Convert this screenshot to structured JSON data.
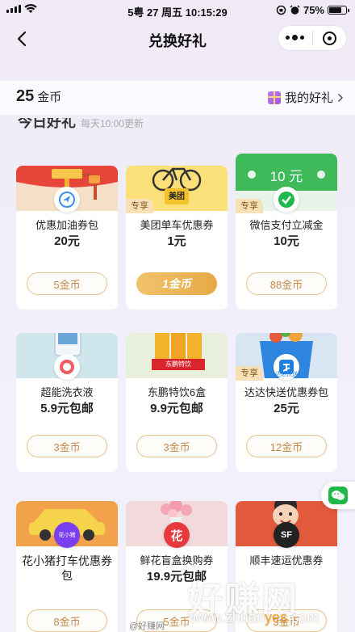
{
  "status_bar": {
    "center": "5粤 27 周五 10:15:29",
    "battery": "75%",
    "battery_level": 0.75
  },
  "nav": {
    "title": "兑换好礼"
  },
  "coins": {
    "amount": "25",
    "unit": "金币",
    "my_gifts": "我的好礼"
  },
  "section": {
    "title": "今日好礼",
    "subtitle": "每天10:00更新"
  },
  "cards": [
    {
      "name": "优惠加油券包",
      "price": "20元",
      "cost": "5金币",
      "tag": "",
      "active": false
    },
    {
      "name": "美团单车优惠券",
      "price": "1元",
      "cost": "1金币",
      "tag": "专享",
      "active": true
    },
    {
      "name": "微信支付立减金",
      "price": "10元",
      "cost": "88金币",
      "tag": "专享",
      "active": false
    },
    {
      "name": "超能洗衣液",
      "price": "5.9元包邮",
      "cost": "3金币",
      "tag": "",
      "active": false
    },
    {
      "name": "东鹏特饮6盒",
      "price": "9.9元包邮",
      "cost": "3金币",
      "tag": "",
      "active": false
    },
    {
      "name": "达达快送优惠券包",
      "price": "25元",
      "cost": "12金币",
      "tag": "专享",
      "active": false
    },
    {
      "name": "花小猪打车优惠券包",
      "price": "",
      "cost": "8金币",
      "tag": "",
      "active": false
    },
    {
      "name": "鲜花盲盒换购券",
      "price": "19.9元包邮",
      "cost": "5金币",
      "tag": "",
      "active": false
    },
    {
      "name": "顺丰速运优惠券",
      "price": "",
      "cost": "3金币",
      "tag": "",
      "active": false
    }
  ],
  "art": {
    "meituan": "美团",
    "wx_amount": "10 元",
    "huaxiaozhu": "花小猪",
    "flower": "花",
    "sf": "SF",
    "dongpeng": "东鹏特饮",
    "dada": "达达快送"
  },
  "watermark": {
    "main": "好赚网",
    "url_a": "www.zhuan",
    "url_b": "yes",
    "url_c": ".com",
    "weibo": "@好赚网"
  }
}
